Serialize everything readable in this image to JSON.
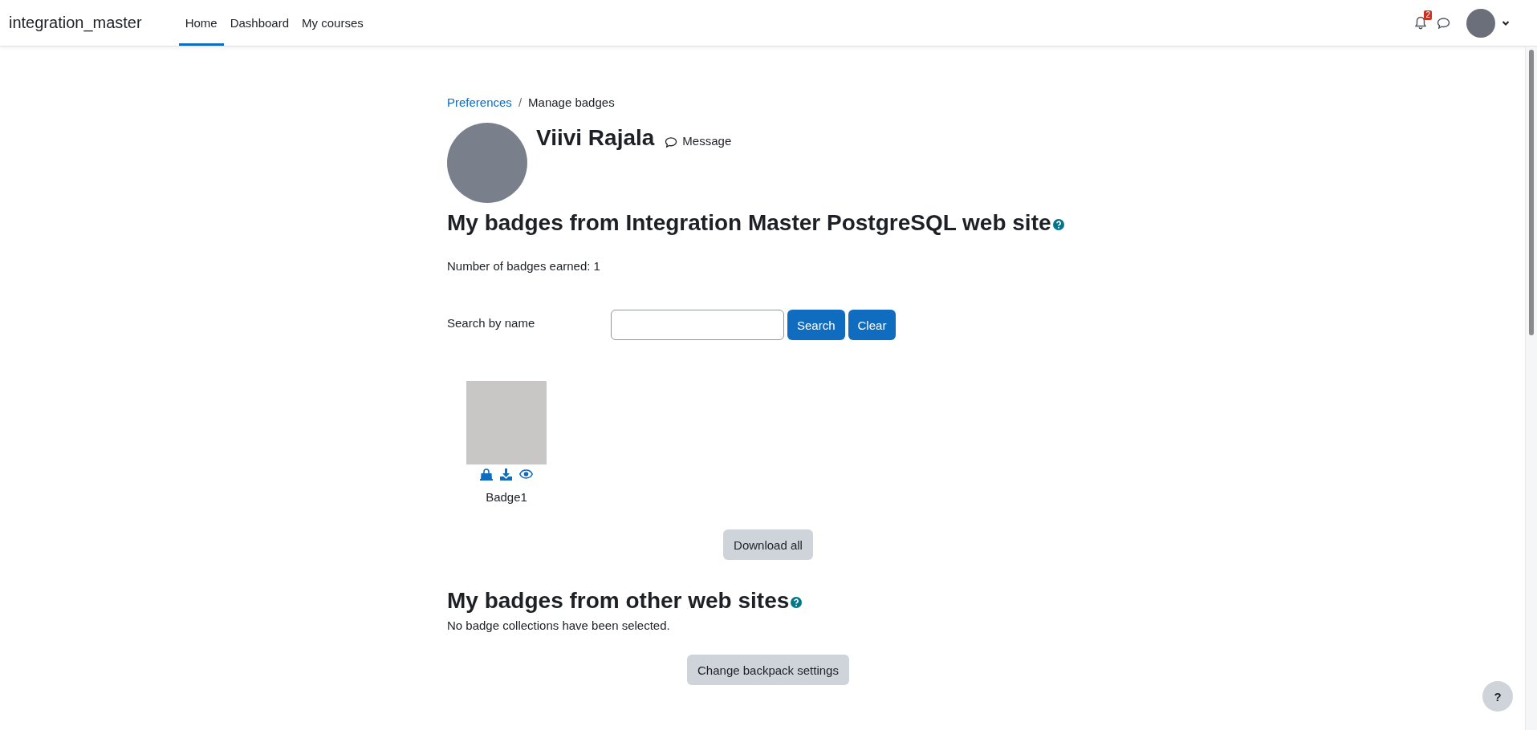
{
  "navbar": {
    "brand": "integration_master",
    "links": [
      {
        "label": "Home",
        "selected": true
      },
      {
        "label": "Dashboard",
        "selected": false
      },
      {
        "label": "My courses",
        "selected": false
      }
    ],
    "notification_count": "2"
  },
  "breadcrumb": {
    "items": [
      {
        "label": "Preferences",
        "kind": "link"
      },
      {
        "label": "Manage badges",
        "kind": "current"
      }
    ],
    "separator": "/"
  },
  "profile": {
    "name": "Viivi Rajala",
    "message_link": "Message"
  },
  "site_badges": {
    "heading": "My badges from Integration Master PostgreSQL web site",
    "earned": "Number of badges earned: 1",
    "search_label": "Search by name",
    "buttons": [
      "Search",
      "Clear"
    ],
    "badges": [
      {
        "name": "Badge1"
      }
    ],
    "download_all": "Download all"
  },
  "other_badges": {
    "heading": "My badges from other web sites",
    "message": "No badge collections have been selected.",
    "button": "Change backpack settings"
  },
  "help_button": "?"
}
